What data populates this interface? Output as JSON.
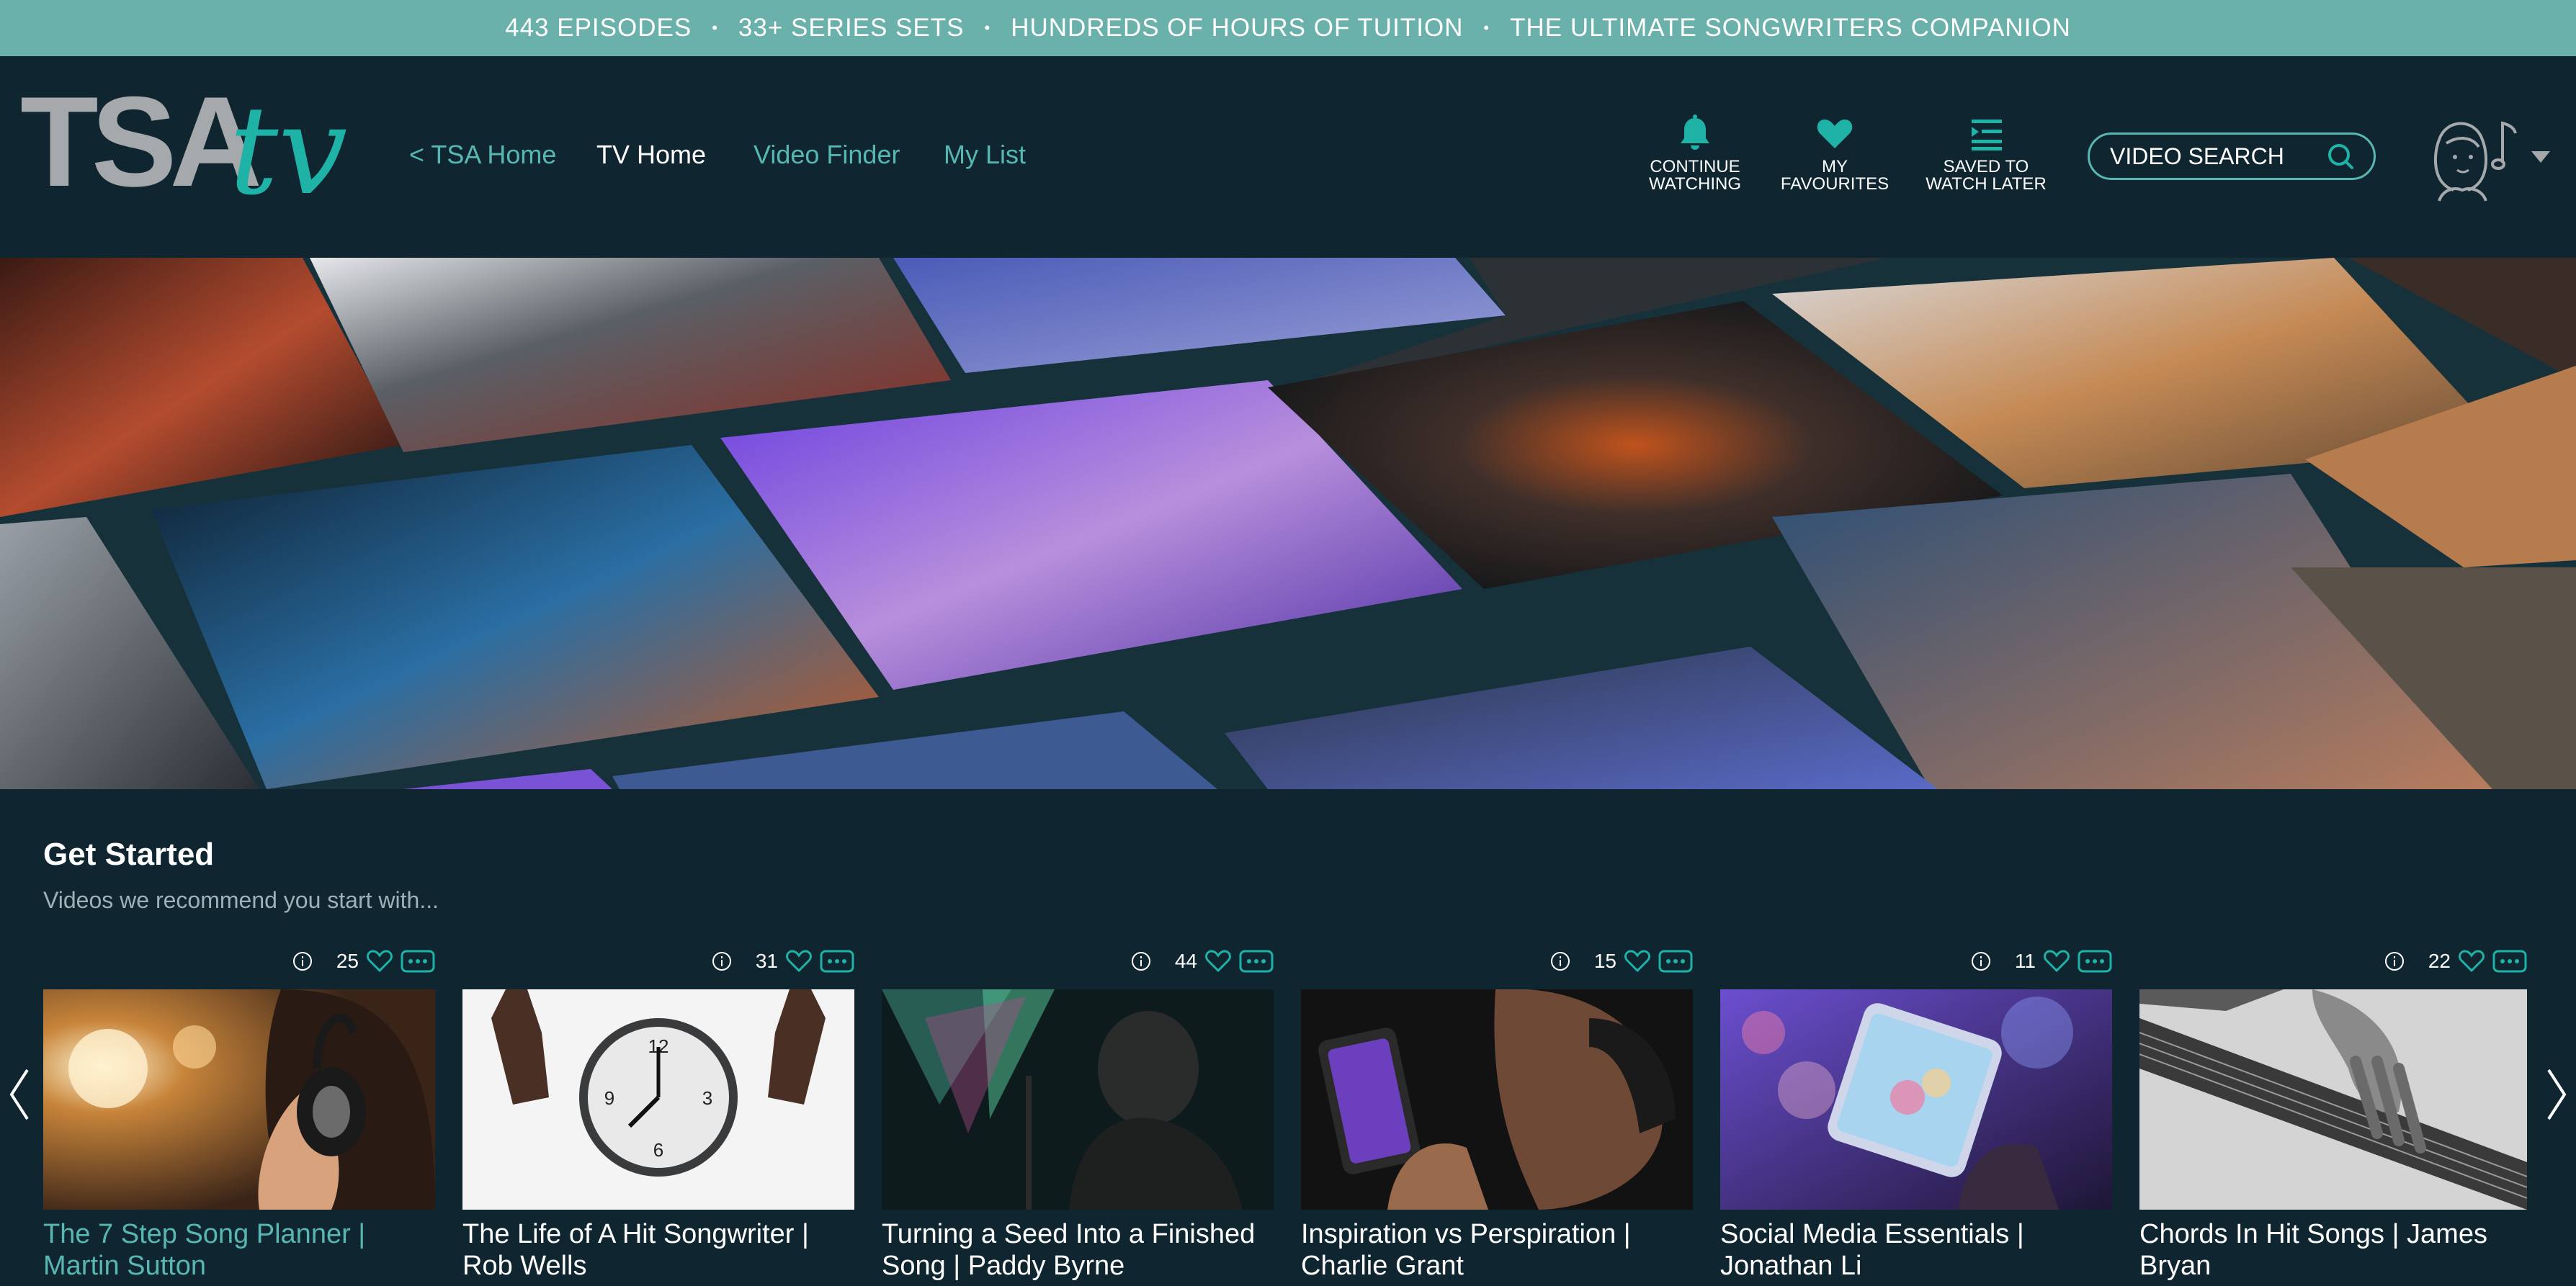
{
  "promo": {
    "items": [
      "443 EPISODES",
      "33+ SERIES SETS",
      "HUNDREDS OF HOURS OF TUITION",
      "THE ULTIMATE SONGWRITERS COMPANION"
    ],
    "separator": "•"
  },
  "header": {
    "logo_text": "TSA",
    "logo_script": "tv",
    "nav": [
      {
        "label": "< TSA Home"
      },
      {
        "label": "TV Home"
      },
      {
        "label": "Video Finder"
      },
      {
        "label": "My List"
      }
    ],
    "actions": [
      {
        "line1": "CONTINUE",
        "line2": "WATCHING",
        "icon": "bell-icon"
      },
      {
        "line1": "MY",
        "line2": "FAVOURITES",
        "icon": "heart-icon"
      },
      {
        "line1": "SAVED TO",
        "line2": "WATCH LATER",
        "icon": "playlist-icon"
      }
    ],
    "search_placeholder": "VIDEO SEARCH"
  },
  "section": {
    "title": "Get Started",
    "subtitle": "Videos we recommend you start with..."
  },
  "cards": [
    {
      "count": "25",
      "title": "The 7 Step Song Planner | Martin Sutton",
      "thumb": "headphones-thumb"
    },
    {
      "count": "31",
      "title": "The Life of A Hit Songwriter | Rob Wells",
      "thumb": "clock-thumb"
    },
    {
      "count": "44",
      "title": "Turning a Seed Into a Finished Song | Paddy Byrne",
      "thumb": "singer-thumb"
    },
    {
      "count": "15",
      "title": "Inspiration vs Perspiration | Charlie Grant",
      "thumb": "phone-music-thumb"
    },
    {
      "count": "11",
      "title": "Social Media Essentials | Jonathan Li",
      "thumb": "smartphone-thumb"
    },
    {
      "count": "22",
      "title": "Chords In Hit Songs | James Bryan",
      "thumb": "guitar-thumb"
    }
  ],
  "colors": {
    "background": "#0f2631",
    "promo": "#6ab1ac",
    "accent": "#58b7b3"
  }
}
